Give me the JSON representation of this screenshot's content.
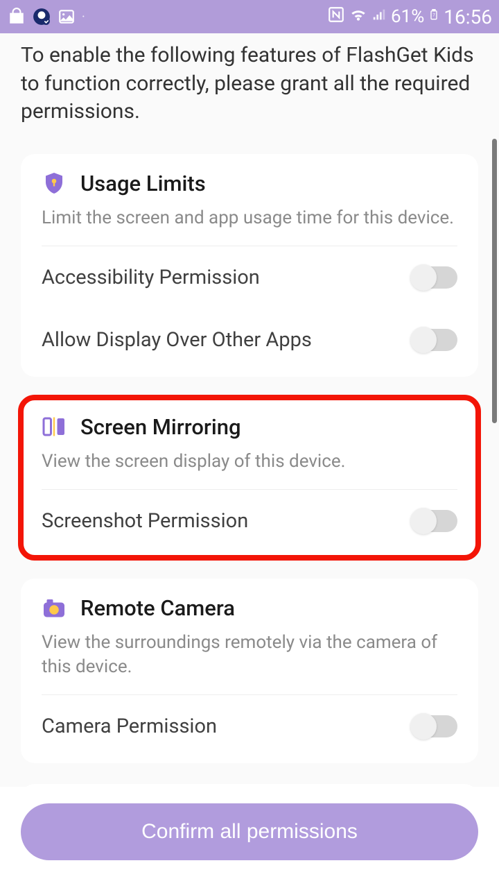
{
  "status_bar": {
    "battery_pct": "61%",
    "time": "16:56"
  },
  "intro_text": "To enable the following features of FlashGet Kids to function correctly, please grant all the required permissions.",
  "cards": {
    "usage_limits": {
      "title": "Usage Limits",
      "desc": "Limit the screen and app usage time for this device.",
      "perm1": "Accessibility Permission",
      "perm2": "Allow Display Over Other Apps"
    },
    "screen_mirroring": {
      "title": "Screen Mirroring",
      "desc": "View the screen display of this device.",
      "perm1": "Screenshot Permission"
    },
    "remote_camera": {
      "title": "Remote Camera",
      "desc": "View the surroundings remotely via the camera of this device.",
      "perm1": "Camera Permission"
    }
  },
  "footer": {
    "confirm_label": "Confirm all permissions"
  }
}
